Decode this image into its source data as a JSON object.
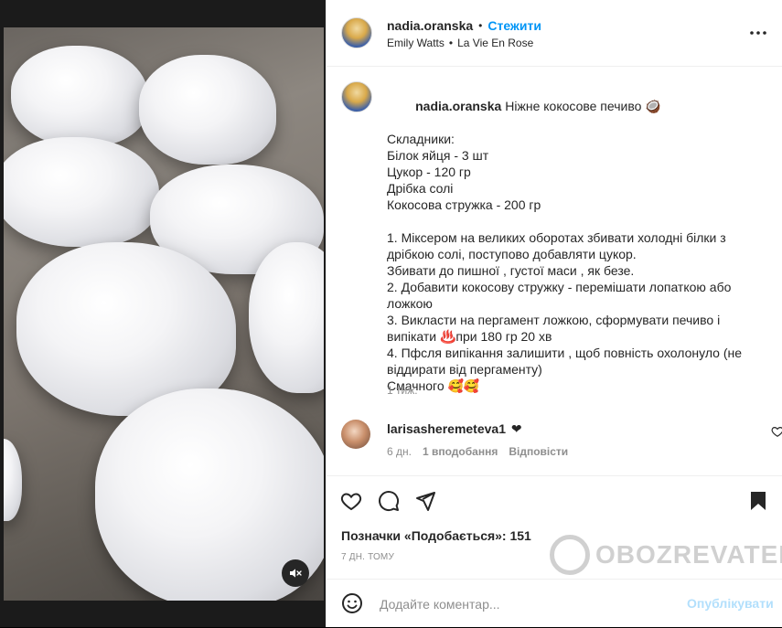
{
  "post": {
    "username": "nadia.oranska",
    "follow_label": "Стежити",
    "audio_artist": "Emily Watts",
    "audio_separator": "•",
    "audio_track": "La Vie En Rose",
    "caption_text": "Ніжне кокосове печиво 🥥\n\nСкладники:\nБілок яйця - 3 шт\nЦукор - 120 гр\nДрібка солі\nКокосова стружка - 200 гр\n\n1. Міксером на великих оборотах збивати холодні білки з дрібкою солі, поступово добавляти цукор.\nЗбивати до пишної , густої маси , як безе.\n2. Добавити кокосову стружку - перемішати лопаткою або ложкою\n3. Викласти на пергамент ложкою, сформувати печиво і випікати ♨️при 180 гр 20 хв\n4. Пфсля випікання залишити , щоб повність охолонуло (не віддирати від пергаменту)\nСмачного 🥰🥰",
    "caption_time": "1 тиж.",
    "likes_text": "Позначки «Подобається»: 151",
    "date_text": "7 ДН. ТОМУ"
  },
  "comment": {
    "username": "larisasheremeteva1",
    "text": "❤",
    "time": "6 дн.",
    "likes": "1 вподобання",
    "reply_label": "Відповісти"
  },
  "add_comment": {
    "placeholder": "Додайте коментар...",
    "post_label": "Опублікувати"
  },
  "watermark": {
    "text": "OBOZREVATEL"
  },
  "icons": {
    "more": "more-horizontal-icon",
    "like": "heart-icon",
    "comment": "comment-icon",
    "share": "share-icon",
    "save": "bookmark-icon",
    "emoji": "emoji-icon",
    "mute": "muted-speaker-icon"
  },
  "colors": {
    "accent": "#0095f6",
    "post_disabled": "#b2dffc",
    "muted_text": "#8e8e8e"
  }
}
